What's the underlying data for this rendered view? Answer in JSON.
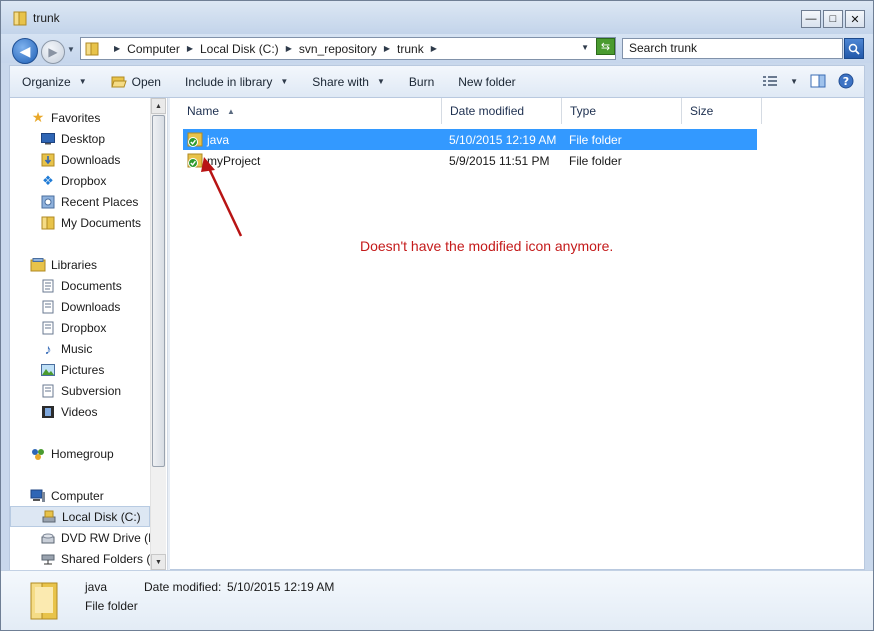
{
  "window": {
    "title": "trunk",
    "controls": [
      "—",
      "□",
      "✕"
    ]
  },
  "address": {
    "crumbs": [
      "Computer",
      "Local Disk (C:)",
      "svn_repository",
      "trunk"
    ],
    "search_placeholder": "Search trunk"
  },
  "toolbar": {
    "organize": "Organize",
    "open": "Open",
    "include_in_library": "Include in library",
    "share_with": "Share with",
    "burn": "Burn",
    "new_folder": "New folder"
  },
  "nav": {
    "favorites": {
      "label": "Favorites",
      "items": [
        "Desktop",
        "Downloads",
        "Dropbox",
        "Recent Places",
        "My Documents"
      ]
    },
    "libraries": {
      "label": "Libraries",
      "items": [
        "Documents",
        "Downloads",
        "Dropbox",
        "Music",
        "Pictures",
        "Subversion",
        "Videos"
      ]
    },
    "homegroup": {
      "label": "Homegroup"
    },
    "computer": {
      "label": "Computer",
      "items": [
        "Local Disk (C:)",
        "DVD RW Drive (D",
        "Shared Folders (\\"
      ],
      "selected_index": 0
    }
  },
  "columns": {
    "name": "Name",
    "date_modified": "Date modified",
    "type": "Type",
    "size": "Size"
  },
  "files": [
    {
      "name": "java",
      "date_modified": "5/10/2015 12:19 AM",
      "type": "File folder",
      "selected": true
    },
    {
      "name": "myProject",
      "date_modified": "5/9/2015 11:51 PM",
      "type": "File folder",
      "selected": false
    }
  ],
  "annotation": {
    "text": "Doesn't have the modified icon anymore.",
    "color": "#c41a1a"
  },
  "details": {
    "name": "java",
    "type": "File folder",
    "date_label": "Date modified:",
    "date_value": "5/10/2015 12:19 AM"
  },
  "colors": {
    "selection": "#3399ff",
    "svn_ok": "#2e9b2e",
    "folder": "#e8c34a"
  }
}
